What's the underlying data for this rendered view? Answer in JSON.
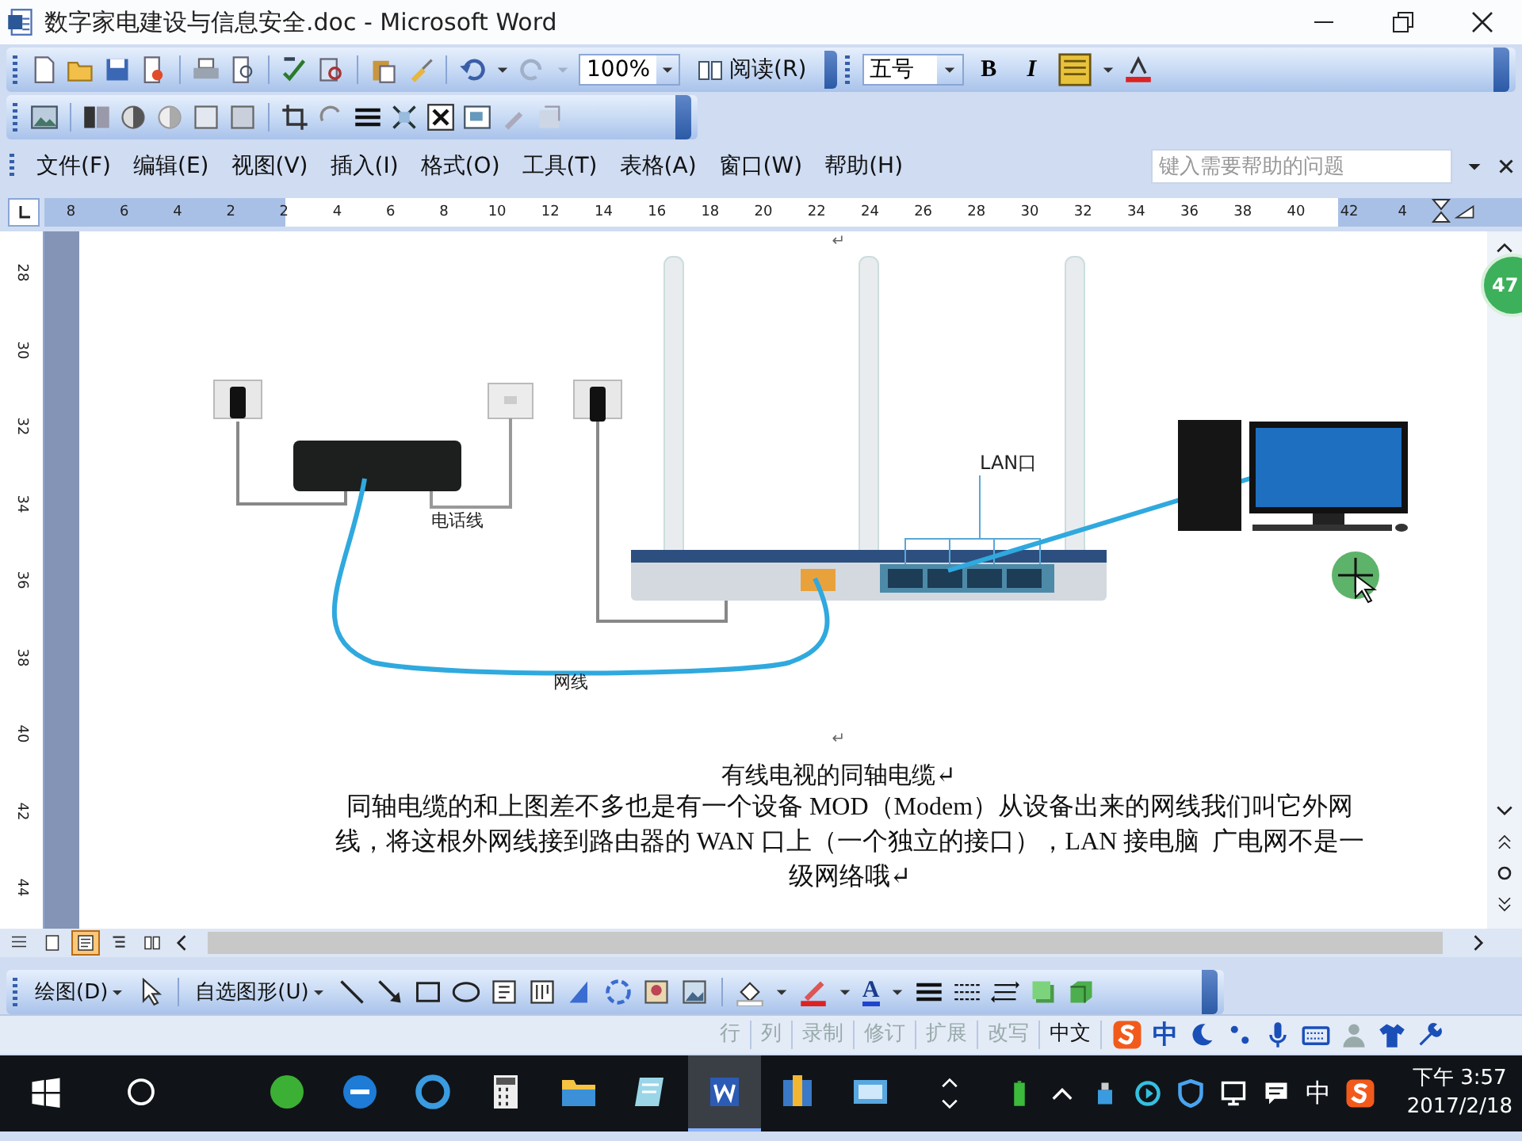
{
  "window": {
    "title": "数字家电建设与信息安全.doc - Microsoft Word"
  },
  "standard_toolbar": {
    "zoom": "100%",
    "read_button": "阅读(R)",
    "font_size": "五号",
    "bold": "B",
    "italic": "I"
  },
  "menu": [
    {
      "label": "文件(F)"
    },
    {
      "label": "编辑(E)"
    },
    {
      "label": "视图(V)"
    },
    {
      "label": "插入(I)"
    },
    {
      "label": "格式(O)"
    },
    {
      "label": "工具(T)"
    },
    {
      "label": "表格(A)"
    },
    {
      "label": "窗口(W)"
    },
    {
      "label": "帮助(H)"
    }
  ],
  "help_box": {
    "placeholder": "键入需要帮助的问题"
  },
  "ruler": {
    "marks": [
      "8",
      "6",
      "4",
      "2",
      "2",
      "4",
      "6",
      "8",
      "10",
      "12",
      "14",
      "16",
      "18",
      "20",
      "22",
      "24",
      "26",
      "28",
      "30",
      "32",
      "34",
      "36",
      "38",
      "40",
      "42",
      "4"
    ]
  },
  "vertical_ruler": {
    "marks": [
      "28",
      "30",
      "32",
      "34",
      "36",
      "38",
      "40",
      "42",
      "44"
    ]
  },
  "document": {
    "blank_marks": [
      "↵",
      "↵"
    ],
    "diagram": {
      "phone_line_label": "电话线",
      "network_cable_label": "网线",
      "lan_label": "LAN口"
    },
    "caption": "有线电视的同轴电缆↵",
    "paragraph": "同轴电缆的和上图差不多也是有一个设备 MOD（Modem）从设备出来的网线我们叫它外网线，将这根外网线接到路由器的 WAN 口上（一个独立的接口），LAN 接电脑  广电网不是一级网络哦↵"
  },
  "float_badge": "47",
  "views": [
    {
      "selected": false
    },
    {
      "selected": false
    },
    {
      "selected": true
    },
    {
      "selected": false
    },
    {
      "selected": false
    }
  ],
  "drawing_toolbar": {
    "draw_menu": "绘图(D)",
    "autoshapes_menu": "自选图形(U)",
    "font_color": "A"
  },
  "status_bar": [
    {
      "label": "行",
      "active": false
    },
    {
      "label": "列",
      "active": false
    },
    {
      "label": "录制",
      "active": false
    },
    {
      "label": "修订",
      "active": false
    },
    {
      "label": "扩展",
      "active": false
    },
    {
      "label": "改写",
      "active": false
    },
    {
      "label": "中文",
      "active": true
    }
  ],
  "ime_bar": {
    "mode": "中"
  },
  "taskbar": {
    "apps": [
      {
        "kind": "chat",
        "active": false
      },
      {
        "kind": "edge",
        "active": false
      },
      {
        "kind": "ie",
        "active": false
      },
      {
        "kind": "calculator",
        "active": false
      },
      {
        "kind": "explorer",
        "active": false
      },
      {
        "kind": "notes",
        "active": false
      },
      {
        "kind": "word",
        "active": true
      },
      {
        "kind": "archive",
        "active": false
      },
      {
        "kind": "window",
        "active": false
      }
    ],
    "input_mode": "中",
    "time": "下午 3:57",
    "date": "2017/2/18"
  }
}
